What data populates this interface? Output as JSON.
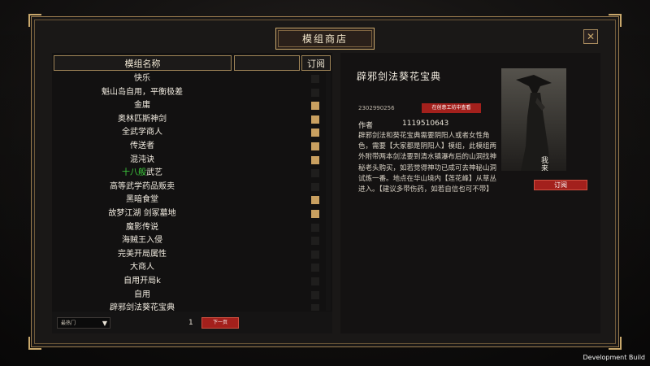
{
  "window": {
    "title": "模组商店"
  },
  "list_header": {
    "name_col": "模组名称",
    "blank_col": "",
    "subscribe_col": "订阅"
  },
  "mods": [
    {
      "name": "快乐",
      "subscribed": false
    },
    {
      "name": "魁山岛自用，平衡极差",
      "subscribed": false
    },
    {
      "name": "金庸",
      "subscribed": true
    },
    {
      "name": "奥林匹斯神剑",
      "subscribed": true
    },
    {
      "name": "全武学商人",
      "subscribed": true
    },
    {
      "name": "传送者",
      "subscribed": true
    },
    {
      "name": "混沌诀",
      "subscribed": true
    },
    {
      "name_parts": [
        "十八般",
        "武艺"
      ],
      "subscribed": false
    },
    {
      "name": "高等武学药品贩卖",
      "subscribed": false
    },
    {
      "name": "黑暗食堂",
      "subscribed": true
    },
    {
      "name": "故梦江湖 剑冢墓地",
      "subscribed": true
    },
    {
      "name": "魔影传说",
      "subscribed": false
    },
    {
      "name": "海贼王入侵",
      "subscribed": false
    },
    {
      "name": "完美开局属性",
      "subscribed": false
    },
    {
      "name": "大商人",
      "subscribed": false
    },
    {
      "name": "自用开局k",
      "subscribed": false
    },
    {
      "name": "自用",
      "subscribed": false
    },
    {
      "name": "辟邪剑法葵花宝典",
      "subscribed": false
    }
  ],
  "footer": {
    "sort_value": "最热门",
    "page_number": "1",
    "next_page": "下一页"
  },
  "detail": {
    "title": "辟邪剑法葵花宝典",
    "id": "2302990256",
    "workshop_button": "在创意工坊中查看",
    "author_label": "作者",
    "author_value": "1119510643",
    "description": "辟邪剑法和葵花宝典需要阴阳人或者女性角色，需要【大家都是阴阳人】模组，此模组两外附带两本剑法要到清水镇瀑布后的山洞找神秘老头购买，如若觉得神功已成可去神秘山洞试炼一番。地点在华山境内【莲花峰】从草丛进入。【建议多带伤药，如若自信也可不带】",
    "preview_caption": "我来自江湖",
    "subscribe_button": "订阅"
  },
  "watermark": "Development Build",
  "colors": {
    "accent_red": "#a3201c",
    "gold_border": "#c9a86c",
    "checked": "#c9a060",
    "green_text": "#3fd23f"
  }
}
